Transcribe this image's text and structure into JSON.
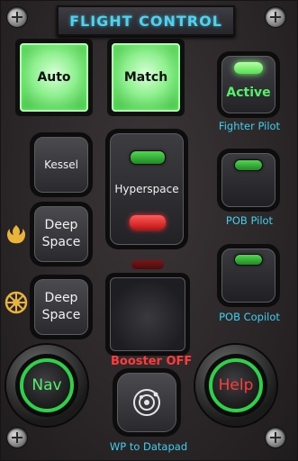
{
  "header": {
    "title": "FLIGHT CONTROL"
  },
  "buttons": {
    "auto": "Auto",
    "match": "Match",
    "active": "Active",
    "kessel": "Kessel",
    "hyperspace": "Hyperspace",
    "deep_space_1": [
      "Deep",
      "Space"
    ],
    "deep_space_2": [
      "Deep",
      "Space"
    ],
    "nav": "Nav",
    "help": "Help"
  },
  "labels": {
    "fighter_pilot": "Fighter Pilot",
    "pob_pilot": "POB Pilot",
    "pob_copilot": "POB Copilot",
    "booster": "Booster OFF",
    "wp_to_datapad": "WP to Datapad"
  },
  "icons": {
    "rebel": "rebel-alliance-icon",
    "empire": "galactic-empire-icon",
    "datapad": "orbit-datapad-icon"
  },
  "colors": {
    "accent_cyan": "#3fd0ee",
    "green_active": "#54f06b",
    "red_alert": "#ff3b3b",
    "emblem_gold": "#e8b43a"
  }
}
